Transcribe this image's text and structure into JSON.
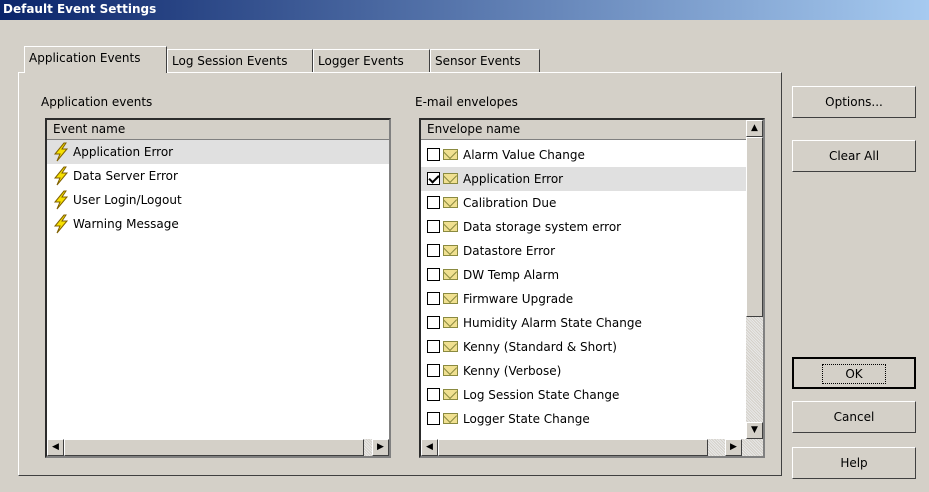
{
  "window": {
    "title": "Default Event Settings"
  },
  "tabs": [
    "Application Events",
    "Log Session Events",
    "Logger Events",
    "Sensor Events"
  ],
  "left": {
    "label": "Application events",
    "header": "Event name",
    "items": [
      "Application Error",
      "Data Server Error",
      "User Login/Logout",
      "Warning Message"
    ],
    "selected_index": 0
  },
  "right": {
    "label": "E-mail envelopes",
    "header": "Envelope name",
    "items": [
      {
        "name": "Alarm Value Change",
        "checked": false
      },
      {
        "name": "Application Error",
        "checked": true
      },
      {
        "name": "Calibration Due",
        "checked": false
      },
      {
        "name": "Data storage system error",
        "checked": false
      },
      {
        "name": "Datastore Error",
        "checked": false
      },
      {
        "name": "DW Temp Alarm",
        "checked": false
      },
      {
        "name": "Firmware Upgrade",
        "checked": false
      },
      {
        "name": "Humidity Alarm State Change",
        "checked": false
      },
      {
        "name": "Kenny (Standard & Short)",
        "checked": false
      },
      {
        "name": "Kenny (Verbose)",
        "checked": false
      },
      {
        "name": "Log Session State Change",
        "checked": false
      },
      {
        "name": "Logger State Change",
        "checked": false
      }
    ],
    "selected_index": 1
  },
  "buttons": {
    "options": "Options...",
    "clear_all": "Clear All",
    "ok": "OK",
    "cancel": "Cancel",
    "help": "Help"
  }
}
